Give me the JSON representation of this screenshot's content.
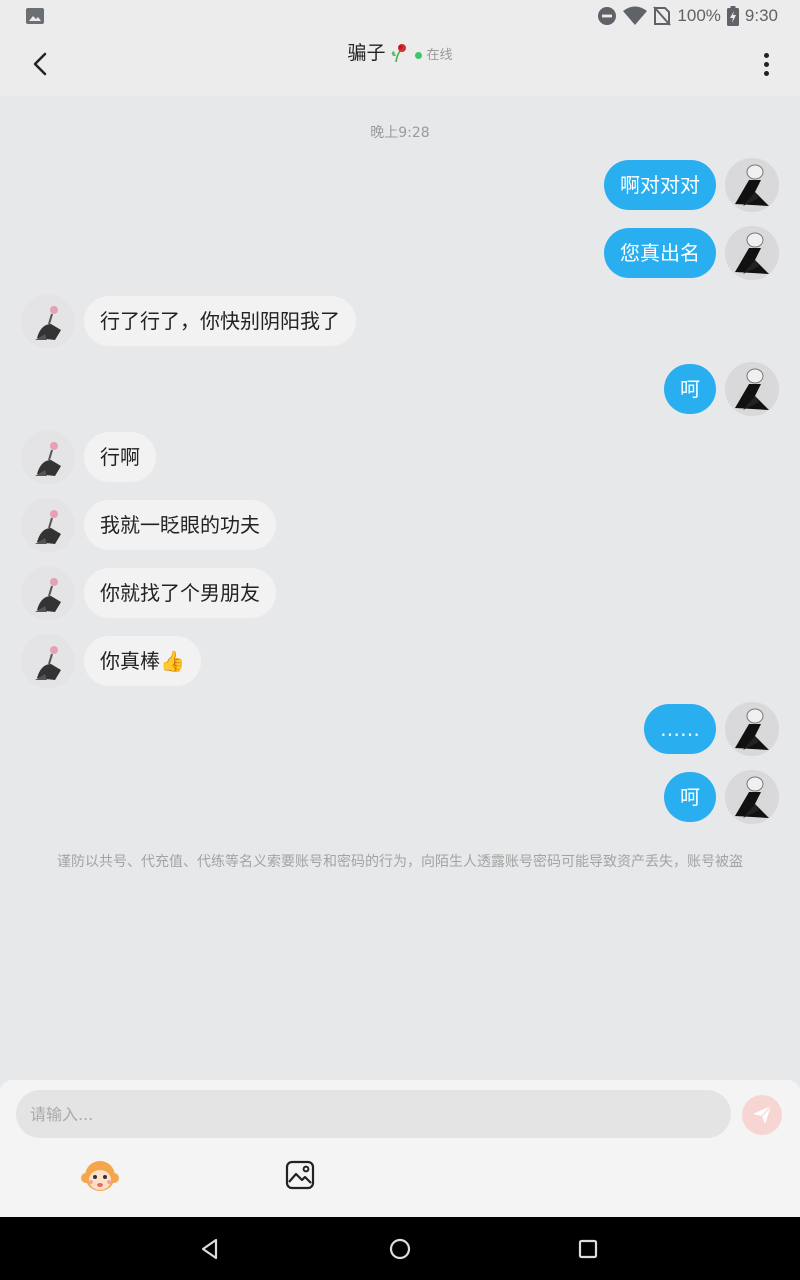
{
  "status_bar": {
    "battery": "100%",
    "time": "9:30",
    "icons": [
      "image-icon",
      "dnd-icon",
      "wifi-icon",
      "no-sim-icon",
      "battery-charging-icon"
    ]
  },
  "header": {
    "title": "骗子",
    "presence": "在线",
    "icons": [
      "back-arrow-icon",
      "wilted-rose-icon",
      "more-vertical-icon"
    ]
  },
  "chat": {
    "timestamp": "晚上9:28",
    "messages": [
      {
        "from": "me",
        "text": "啊对对对"
      },
      {
        "from": "me",
        "text": "您真出名"
      },
      {
        "from": "them",
        "text": "行了行了，你快别阴阳我了"
      },
      {
        "from": "me",
        "text": "呵"
      },
      {
        "from": "them",
        "text": "行啊"
      },
      {
        "from": "them",
        "text": "我就一眨眼的功夫"
      },
      {
        "from": "them",
        "text": "你就找了个男朋友"
      },
      {
        "from": "them",
        "text": "你真棒👍"
      },
      {
        "from": "me",
        "text": "……"
      },
      {
        "from": "me",
        "text": "呵"
      }
    ],
    "warning": "谨防以共号、代充值、代练等名义索要账号和密码的行为，向陌生人透露账号密码可能导致资产丢失，账号被盗"
  },
  "composer": {
    "placeholder": "请输入...",
    "icons": [
      "send-icon",
      "emoji-monkey-icon",
      "image-picker-icon"
    ]
  },
  "colors": {
    "my_bubble": "#29aef0",
    "their_bubble": "#f2f2f3",
    "background": "#e7e8ea",
    "online_dot": "#3cc66b"
  }
}
